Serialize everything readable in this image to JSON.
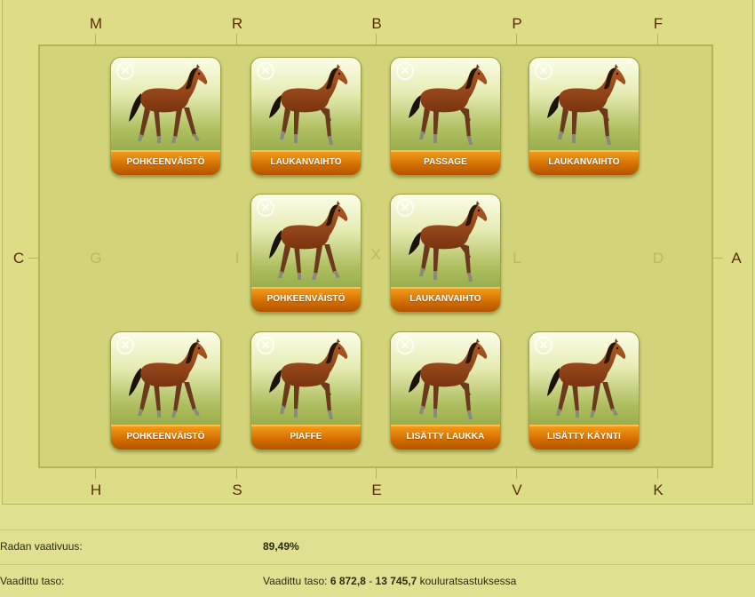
{
  "arena": {
    "top_letters": [
      "M",
      "R",
      "B",
      "P",
      "F"
    ],
    "bottom_letters": [
      "H",
      "S",
      "E",
      "V",
      "K"
    ],
    "left_letter": "C",
    "right_letter": "A",
    "center_letters": [
      "G",
      "I",
      "X",
      "L",
      "D"
    ]
  },
  "cards": [
    {
      "label": "POHKEENVÄISTÖ",
      "pose": "walk"
    },
    {
      "label": "LAUKANVAIHTO",
      "pose": "canter"
    },
    {
      "label": "PASSAGE",
      "pose": "canter"
    },
    {
      "label": "LAUKANVAIHTO",
      "pose": "canter"
    },
    {
      "label": "POHKEENVÄISTÖ",
      "pose": "walk"
    },
    {
      "label": "LAUKANVAIHTO",
      "pose": "canter"
    },
    {
      "label": "POHKEENVÄISTÖ",
      "pose": "walk"
    },
    {
      "label": "PIAFFE",
      "pose": "canter"
    },
    {
      "label": "LISÄTTY LAUKKA",
      "pose": "canter"
    },
    {
      "label": "LISÄTTY KÄYNTI",
      "pose": "walk"
    }
  ],
  "close_glyph": "✕",
  "info": {
    "difficulty_label": "Radan vaativuus:",
    "difficulty_value": "89,49%",
    "level_label": "Vaadittu taso:",
    "level_prefix": "Vaadittu taso: ",
    "level_min": "6 872,8",
    "level_sep": " - ",
    "level_max": "13 745,7",
    "level_suffix": " kouluratsastuksessa"
  }
}
